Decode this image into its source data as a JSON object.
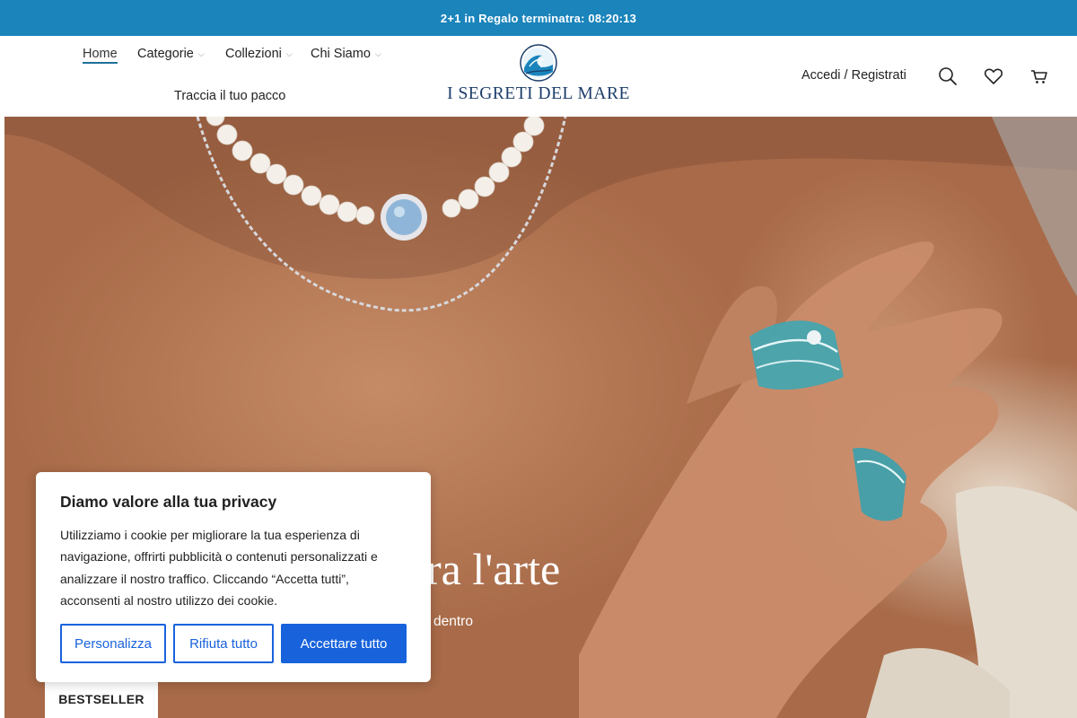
{
  "announcement": {
    "text": "2+1 in Regalo terminatra: 08:20:13"
  },
  "nav": {
    "items": [
      {
        "label": "Home"
      },
      {
        "label": "Categorie"
      },
      {
        "label": "Collezioni"
      },
      {
        "label": "Chi Siamo"
      },
      {
        "label": "Traccia il tuo pacco"
      }
    ],
    "chevron": "⌵"
  },
  "brand": {
    "name": "I SEGRETI DEL MARE",
    "logo_colors": {
      "blue": "#1a84bb",
      "navy": "#1d3e6b"
    }
  },
  "header": {
    "login_label": "Accedi / Registrati",
    "icons": [
      "search-icon",
      "heart-icon",
      "cart-icon"
    ]
  },
  "hero": {
    "heading_visible": "ra l'arte",
    "subtext_visible": "dentro"
  },
  "bestseller_label": "BESTSELLER",
  "cookie_banner": {
    "title": "Diamo valore alla tua privacy",
    "text": "Utilizziamo i cookie per migliorare la tua esperienza di navigazione, offrirti pubblicità o contenuti personalizzati e analizzare il nostro traffico. Cliccando “Accetta tutti”, acconsenti al nostro utilizzo dei cookie.",
    "buttons": {
      "customize": "Personalizza",
      "reject": "Rifiuta tutto",
      "accept": "Accettare tutto"
    },
    "accent_color": "#1863dc"
  },
  "colors": {
    "announcement_bg": "#1a84bb"
  }
}
